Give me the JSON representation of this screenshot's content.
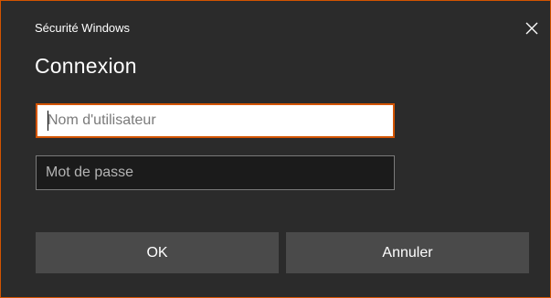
{
  "window": {
    "caption": "Sécurité Windows",
    "accent_color": "#d35400"
  },
  "dialog": {
    "title": "Connexion",
    "username_placeholder": "Nom d'utilisateur",
    "username_value": "",
    "password_placeholder": "Mot de passe",
    "password_value": ""
  },
  "buttons": {
    "ok_label": "OK",
    "cancel_label": "Annuler"
  },
  "icons": {
    "close": "close-icon"
  }
}
